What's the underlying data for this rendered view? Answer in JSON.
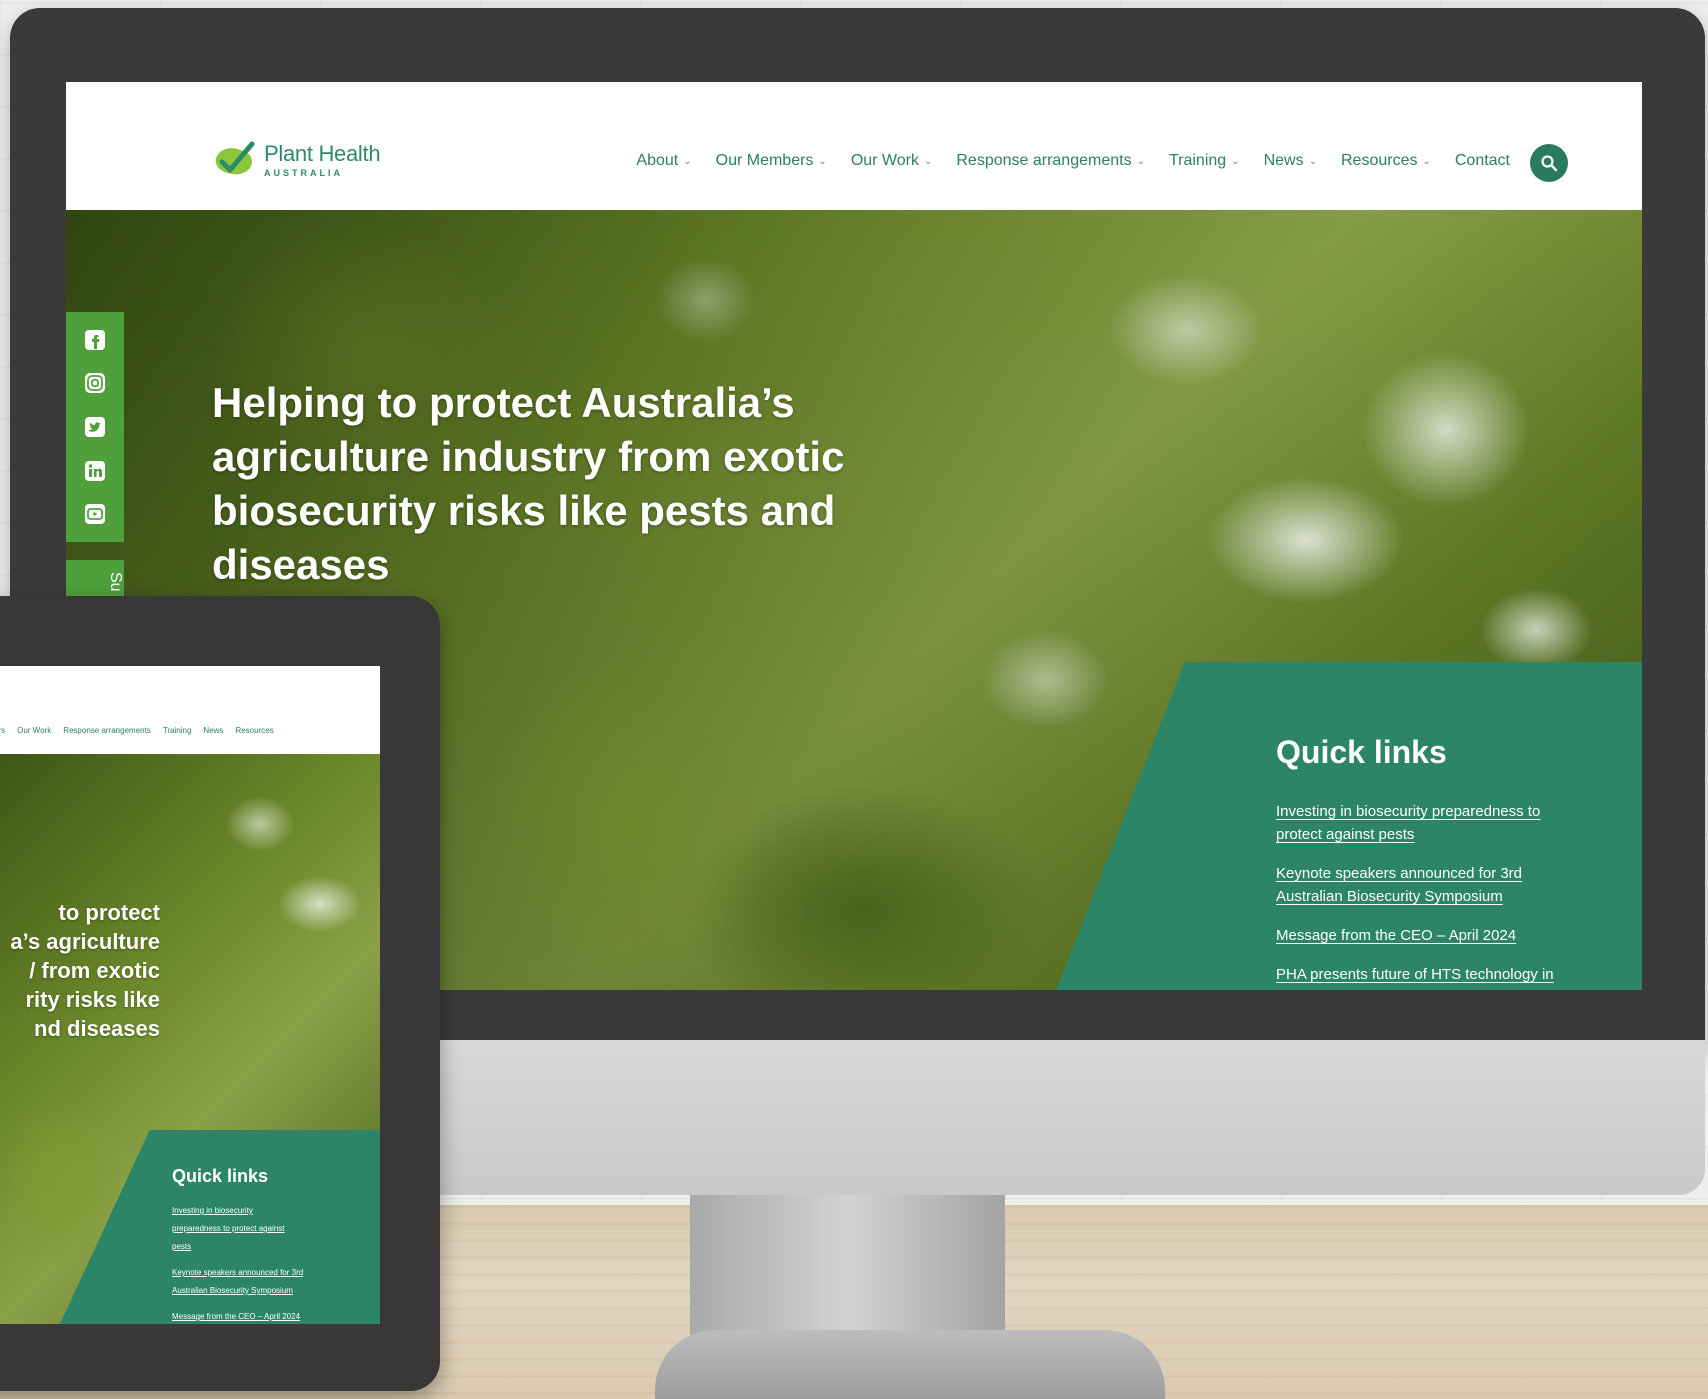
{
  "desktop": {
    "logo": {
      "name": "Plant Health",
      "sub": "AUSTRALIA"
    },
    "nav": [
      {
        "label": "About",
        "dropdown": true
      },
      {
        "label": "Our Members",
        "dropdown": true
      },
      {
        "label": "Our Work",
        "dropdown": true
      },
      {
        "label": "Response arrangements",
        "dropdown": true
      },
      {
        "label": "Training",
        "dropdown": true
      },
      {
        "label": "News",
        "dropdown": true
      },
      {
        "label": "Resources",
        "dropdown": true
      },
      {
        "label": "Contact",
        "dropdown": false
      }
    ],
    "search_icon": "search-icon",
    "social": [
      "facebook-icon",
      "instagram-icon",
      "twitter-icon",
      "linkedin-icon",
      "youtube-icon"
    ],
    "subscribe_label": "Su",
    "hero_title": "Helping to protect Australia’s agriculture industry from exotic biosecurity risks like pests and diseases",
    "quick_links": {
      "title": "Quick links",
      "items": [
        "Investing in biosecurity preparedness to protect against pests",
        "Keynote speakers announced for 3rd Australian Biosecurity Symposium",
        "Message from the CEO – April 2024",
        "PHA presents future of HTS technology in"
      ]
    }
  },
  "tablet": {
    "nav": [
      "ers",
      "Our Work",
      "Response arrangements",
      "Training",
      "News",
      "Resources"
    ],
    "hero_title": "to protect\na’s agriculture\n/ from exotic\nrity risks like\nnd diseases",
    "quick_links": {
      "title": "Quick links",
      "items": [
        "Investing in biosecurity preparedness to protect against pests",
        "Keynote speakers announced for 3rd Australian Biosecurity Symposium",
        "Message from the CEO – April 2024"
      ]
    }
  },
  "colors": {
    "brand_green": "#2e8b66",
    "panel_green": "#2b8566",
    "social_green": "#4fa03c",
    "bezel": "#3a3a3a"
  }
}
